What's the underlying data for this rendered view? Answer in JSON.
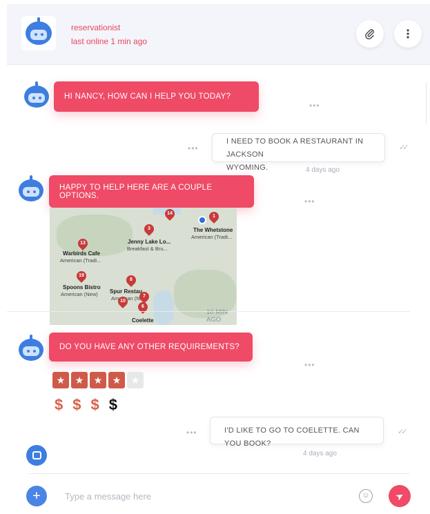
{
  "header": {
    "name": "reservationist",
    "status": "last online 1 min ago",
    "attach_icon": "paperclip-icon",
    "menu_icon": "vertical-dots-icon"
  },
  "messages": {
    "m1": {
      "text": "HI NANCY, HOW CAN I HELP YOU TODAY?"
    },
    "m2": {
      "text_line1": "I NEED TO BOOK A RESTAURANT IN JACKSON",
      "text_line2": "WYOMING.",
      "time": "4 days ago"
    },
    "m3": {
      "text": "HAPPY TO HELP HERE ARE A COUPLE OPTIONS."
    },
    "map": {
      "time": "10 MIN AGO",
      "pins": [
        {
          "num": "14"
        },
        {
          "num": "1"
        },
        {
          "num": "3"
        },
        {
          "num": "13"
        },
        {
          "num": "19"
        },
        {
          "num": "8"
        },
        {
          "num": "7"
        },
        {
          "num": "10"
        },
        {
          "num": "6"
        }
      ],
      "places": {
        "whetstone_name": "The Whetstone",
        "whetstone_sub": "American (Tradi...",
        "jenny_name": "Jenny Lake Lo...",
        "jenny_sub": "Breakfast & Bru...",
        "warbirds_name": "Warbirds Cafe",
        "warbirds_sub": "American (Tradi...",
        "spoons_name": "Spoons Bistro",
        "spoons_sub": "American (New)",
        "spur_name": "Spur Restau...",
        "spur_sub": "American (N...",
        "coelette_name": "Coelette"
      }
    },
    "m4": {
      "text": "DO YOU HAVE ANY OTHER REQUIREMENTS?"
    },
    "rating": {
      "value": 4,
      "max": 5
    },
    "price": {
      "symbol": "$",
      "level": 3,
      "max": 4
    },
    "m5": {
      "text": "I'D LIKE TO GO TO COELETTE. CAN YOU BOOK?",
      "time": "4 days ago"
    }
  },
  "compose": {
    "placeholder": "Type a message here",
    "plus_label": "+",
    "emoji_label": "☺",
    "send_label": "➤"
  },
  "typing_dots": "•••",
  "read_check": "✓✓",
  "colors": {
    "accent": "#ef4a66",
    "blue": "#3d7ee0",
    "star": "#d05a4a",
    "price": "#d6634c"
  }
}
